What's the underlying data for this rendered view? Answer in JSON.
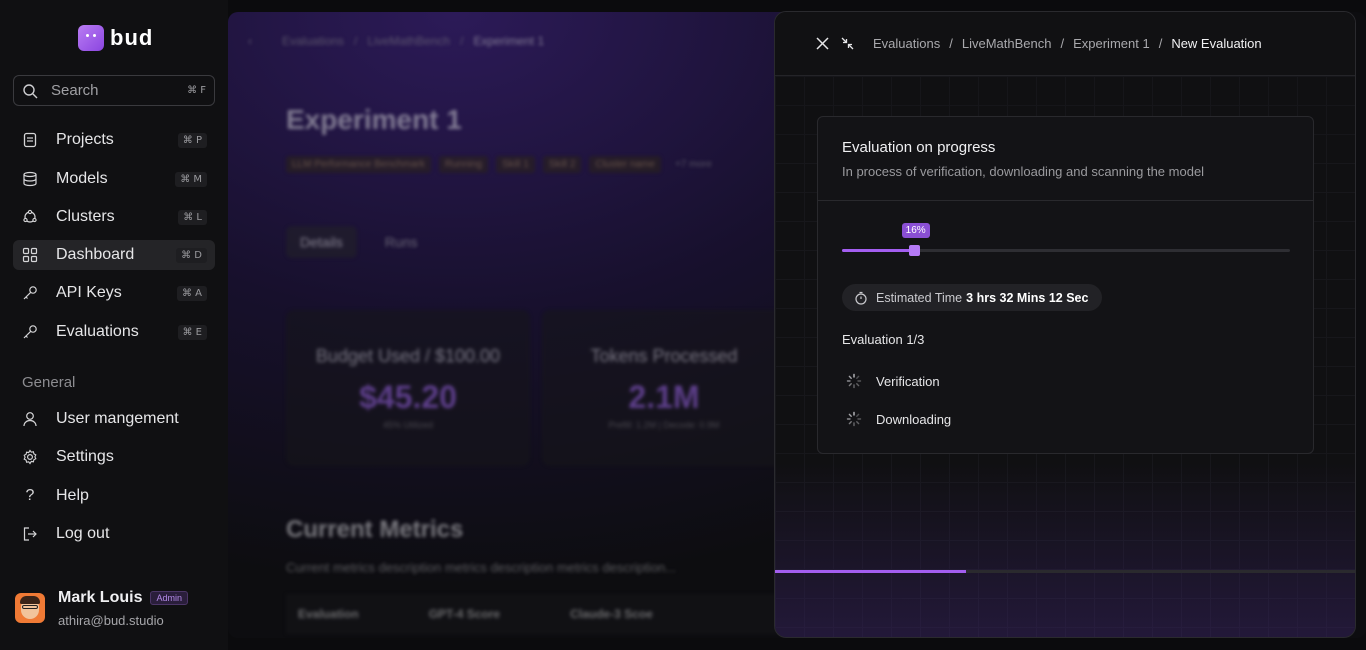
{
  "brand": {
    "name": "bud"
  },
  "search": {
    "label": "Search",
    "shortcut": "⌘ F"
  },
  "nav": [
    {
      "label": "Projects",
      "shortcut": "⌘ P",
      "icon": "document-icon"
    },
    {
      "label": "Models",
      "shortcut": "⌘ M",
      "icon": "database-icon"
    },
    {
      "label": "Clusters",
      "shortcut": "⌘ L",
      "icon": "cluster-icon"
    },
    {
      "label": "Dashboard",
      "shortcut": "⌘ D",
      "icon": "grid-icon",
      "active": true
    },
    {
      "label": "API Keys",
      "shortcut": "⌘ A",
      "icon": "key-icon"
    },
    {
      "label": "Evaluations",
      "shortcut": "⌘ E",
      "icon": "key-icon"
    }
  ],
  "general": {
    "heading": "General",
    "items": [
      {
        "label": "User mangement",
        "icon": "user-icon"
      },
      {
        "label": "Settings",
        "icon": "gear-icon"
      },
      {
        "label": "Help",
        "icon": "question-icon"
      },
      {
        "label": "Log out",
        "icon": "logout-icon"
      }
    ]
  },
  "user": {
    "name": "Mark Louis",
    "role": "Admin",
    "email": "athira@bud.studio"
  },
  "background": {
    "breadcrumb": [
      "Evaluations",
      "/",
      "LiveMathBench",
      "/",
      "Experiment 1"
    ],
    "title": "Experiment 1",
    "tags": [
      "LLM Performance Benchmark",
      "Running",
      "Skill 1",
      "Skill 2",
      "Cluster name",
      "+7 more"
    ],
    "tabs": [
      "Details",
      "Runs"
    ],
    "cards": [
      {
        "title": "Budget Used / $100.00",
        "value": "$45.20",
        "sub": "45% Utilized"
      },
      {
        "title": "Tokens Processed",
        "value": "2.1M",
        "sub": "Prefill: 1.2M | Decode: 0.9M"
      }
    ],
    "metrics_title": "Current Metrics",
    "metrics_desc": "Current metrics description metrics description metrics description...",
    "table_headers": [
      "Evaluation",
      "GPT-4 Score",
      "Claude-3 Scoe"
    ]
  },
  "drawer": {
    "breadcrumb": [
      "Evaluations",
      "LiveMathBench",
      "Experiment 1",
      "New Evaluation"
    ],
    "panel_title": "Evaluation on progress",
    "panel_subtitle": "In process of verification, downloading and scanning the model",
    "progress": 16,
    "progress_label": "16%",
    "eta_label": "Estimated Time",
    "eta_value": "3 hrs 32 Mins 12 Sec",
    "eval_count": "Evaluation 1/3",
    "steps": [
      "Verification",
      "Downloading"
    ],
    "footer_progress": 33
  },
  "colors": {
    "accent": "#a35ef0",
    "background": "#0b0b0d"
  }
}
